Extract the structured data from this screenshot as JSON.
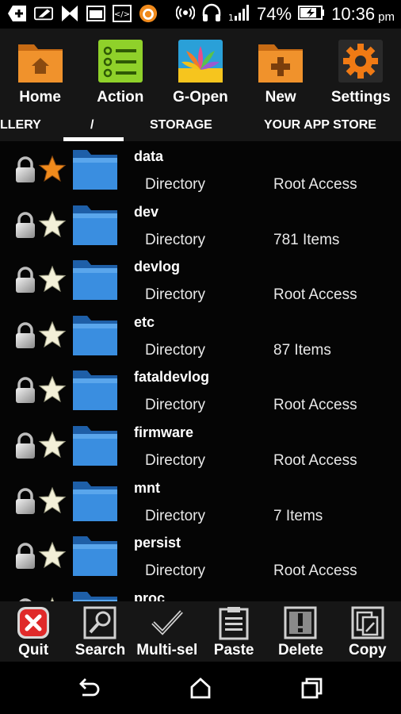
{
  "status_bar": {
    "battery": "74%",
    "time": "10:36",
    "ampm": "pm",
    "icons": [
      "plus-icon",
      "eraser-icon",
      "xbox-icon",
      "window-icon",
      "code-icon",
      "avast-icon",
      "wifi-hotspot-icon",
      "headphones-icon",
      "signal-icon",
      "battery-icon"
    ]
  },
  "toolbar": {
    "items": [
      {
        "label": "Home",
        "icon": "home-folder-icon"
      },
      {
        "label": "Action",
        "icon": "checklist-icon"
      },
      {
        "label": "G-Open",
        "icon": "lotus-icon"
      },
      {
        "label": "New",
        "icon": "new-folder-icon"
      },
      {
        "label": "Settings",
        "icon": "gear-icon"
      }
    ]
  },
  "tabs": {
    "items": [
      "LLERY",
      "/",
      "STORAGE",
      "YOUR APP STORE"
    ],
    "active_index": 1
  },
  "files": [
    {
      "name": "data",
      "type": "Directory",
      "info": "Root Access",
      "starred": true
    },
    {
      "name": "dev",
      "type": "Directory",
      "info": "781 Items",
      "starred": false
    },
    {
      "name": "devlog",
      "type": "Directory",
      "info": "Root Access",
      "starred": false
    },
    {
      "name": "etc",
      "type": "Directory",
      "info": "87 Items",
      "starred": false
    },
    {
      "name": "fataldevlog",
      "type": "Directory",
      "info": "Root Access",
      "starred": false
    },
    {
      "name": "firmware",
      "type": "Directory",
      "info": "Root Access",
      "starred": false
    },
    {
      "name": "mnt",
      "type": "Directory",
      "info": "7 Items",
      "starred": false
    },
    {
      "name": "persist",
      "type": "Directory",
      "info": "Root Access",
      "starred": false
    },
    {
      "name": "proc",
      "type": "",
      "info": "",
      "starred": false
    }
  ],
  "bottom_bar": {
    "items": [
      {
        "label": "Quit",
        "icon": "quit-icon"
      },
      {
        "label": "Search",
        "icon": "search-icon"
      },
      {
        "label": "Multi-sel",
        "icon": "checkmark-icon"
      },
      {
        "label": "Paste",
        "icon": "paste-icon"
      },
      {
        "label": "Delete",
        "icon": "delete-icon"
      },
      {
        "label": "Copy",
        "icon": "copy-icon"
      }
    ]
  },
  "nav_bar": {
    "items": [
      "back-icon",
      "home-icon",
      "recents-icon"
    ]
  },
  "colors": {
    "accent_orange": "#f08a1c",
    "folder_blue": "#3a8ee0",
    "quit_red": "#e02a2a"
  }
}
